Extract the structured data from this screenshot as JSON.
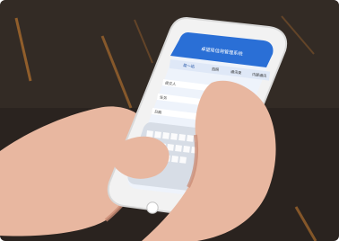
{
  "scene": {
    "description_visible_text": [],
    "phone_app": {
      "title": "卓望局信用管理系统",
      "tab_active": "局一站",
      "tabs": [
        "拍照",
        "通讯录",
        "内部通讯"
      ],
      "field_labels": [
        "提交人",
        "任务",
        "日期"
      ]
    },
    "colors": {
      "floor": "#2a231f",
      "floor_light": "#4b3f35",
      "phone_body": "#f2f2f2",
      "screen_header": "#2a6fd6",
      "screen_bg": "#eef3fb",
      "keyboard": "#d7dde6",
      "skin": "#e8b7a0",
      "skin_shadow": "#c98b74",
      "wood_stripe": "#a2682d"
    }
  }
}
